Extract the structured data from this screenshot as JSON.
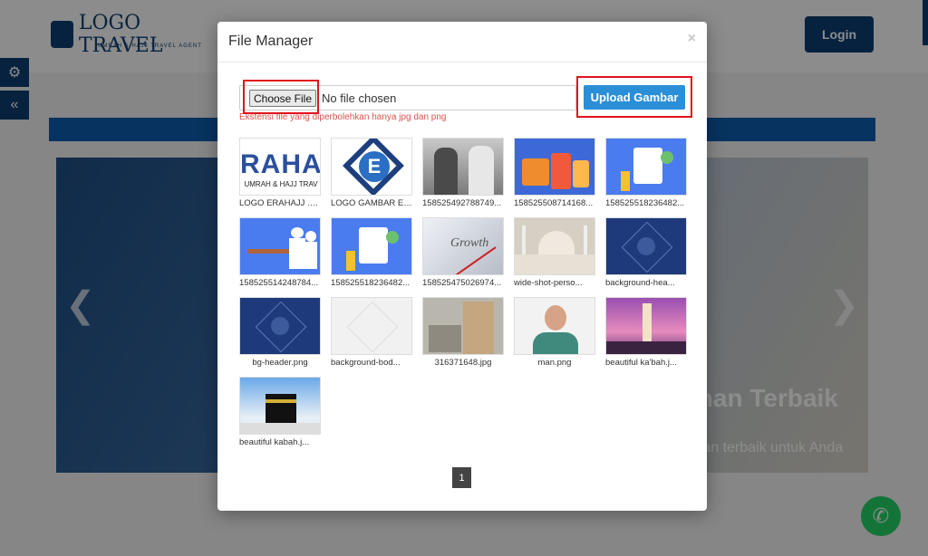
{
  "background": {
    "logo_text": "LOGO TRAVEL",
    "logo_sub": "UMRAH & HAJJ TRAVEL AGENT",
    "login_label": "Login",
    "slide_title": "man Terbaik",
    "slide_subtitle": "man terbaik untuk Anda",
    "slide_prev": "❮",
    "slide_next": "❯"
  },
  "modal": {
    "title": "File Manager",
    "close_symbol": "×",
    "choose_file_label": "Choose File",
    "file_status": "No file chosen",
    "upload_label": "Upload Gambar",
    "hint": "Ekstensi file yang diperbolehkan hanya jpg dan png",
    "files": [
      {
        "caption": "LOGO ERAHAJJ .p...",
        "kind": "logo-erahajj"
      },
      {
        "caption": "LOGO GAMBAR ER...",
        "kind": "logo-e"
      },
      {
        "caption": "158525492788749...",
        "kind": "photo-people"
      },
      {
        "caption": "158525508714168...",
        "kind": "suitcases"
      },
      {
        "caption": "158525518236482...",
        "kind": "illustration-blue"
      },
      {
        "caption": "158525514248784...",
        "kind": "chefs"
      },
      {
        "caption": "158525518236482...",
        "kind": "illustration-blue"
      },
      {
        "caption": "158525475026974...",
        "kind": "growth"
      },
      {
        "caption": "wide-shot-perso...",
        "kind": "mosque"
      },
      {
        "caption": "background-hea...",
        "kind": "pattern-navy"
      },
      {
        "caption": "bg-header.png",
        "kind": "pattern-navy"
      },
      {
        "caption": "background-bod...",
        "kind": "pattern-white"
      },
      {
        "caption": "316371648.jpg",
        "kind": "city"
      },
      {
        "caption": "man.png",
        "kind": "man"
      },
      {
        "caption": "beautiful ka'bah.j...",
        "kind": "kabah-night"
      },
      {
        "caption": "beautiful kabah.j...",
        "kind": "kabah-day"
      }
    ],
    "page_number": "1"
  }
}
